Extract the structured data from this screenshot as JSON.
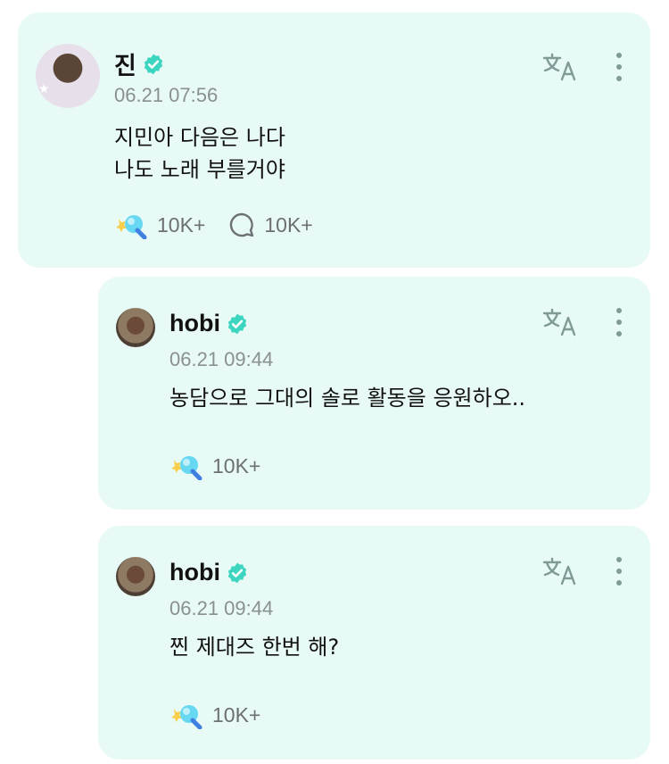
{
  "post": {
    "author": "진",
    "time": "06.21 07:56",
    "text": "지민아 다음은 나다\n나도 노래 부를거야",
    "likes": "10K+",
    "comments": "10K+"
  },
  "replies": [
    {
      "author": "hobi",
      "time": "06.21 09:44",
      "text": "농담으로 그대의 솔로 활동을 응원하오..",
      "likes": "10K+"
    },
    {
      "author": "hobi",
      "time": "06.21 09:44",
      "text": "찐 제대즈 한번 해?",
      "likes": "10K+"
    }
  ],
  "colors": {
    "card_bg": "#e8faf6",
    "verified": "#3cd6c0",
    "icon": "#6f8d8a"
  }
}
